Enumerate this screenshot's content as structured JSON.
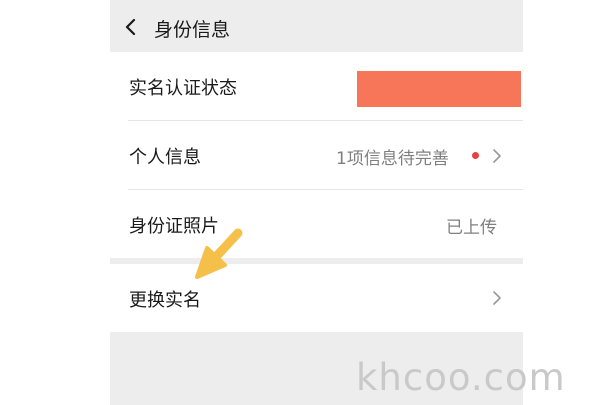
{
  "header": {
    "title": "身份信息",
    "back_icon": "chevron-left-icon"
  },
  "rows": [
    {
      "label": "实名认证状态",
      "value": "",
      "value_redacted": true
    },
    {
      "label": "个人信息",
      "value": "1项信息待完善",
      "has_dot": true,
      "has_chevron": true
    },
    {
      "label": "身份证照片",
      "value": "已上传"
    }
  ],
  "change_row": {
    "label": "更换实名",
    "has_chevron": true
  },
  "annotation": {
    "icon": "arrow-pointer-icon",
    "color": "#f5c04a"
  },
  "colors": {
    "background": "#ededed",
    "card": "#ffffff",
    "redaction": "#f7765a",
    "dot": "#e64340"
  },
  "watermark": "khcoo.com"
}
